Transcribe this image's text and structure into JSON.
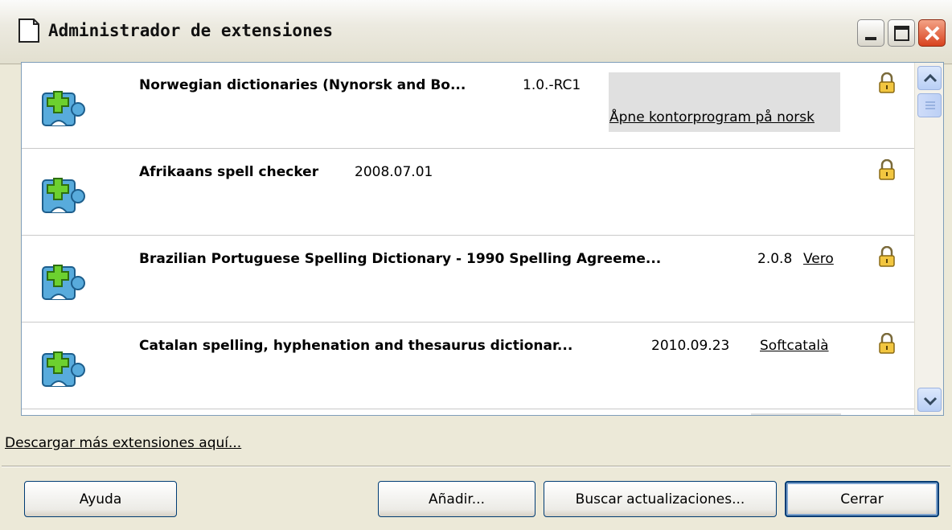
{
  "window": {
    "title": "Administrador de extensiones"
  },
  "extensions": [
    {
      "name": "Norwegian dictionaries (Nynorsk and Bo...",
      "version": "1.0.-RC1",
      "publisher_link": "Åpne kontorprogram på norsk"
    },
    {
      "name": "Afrikaans spell checker",
      "version": "2008.07.01",
      "publisher_link": ""
    },
    {
      "name": "Brazilian Portuguese Spelling Dictionary - 1990 Spelling Agreeme...",
      "version": "2.0.8",
      "publisher_link": "Vero"
    },
    {
      "name": "Catalan spelling, hyphenation and thesaurus dictionar...",
      "version": "2010.09.23",
      "publisher_link": "Softcatalà"
    }
  ],
  "links": {
    "more_extensions": "Descargar más extensiones aquí..."
  },
  "buttons": {
    "help": "Ayuda",
    "add": "Añadir...",
    "check_updates": "Buscar actualizaciones...",
    "close": "Cerrar"
  },
  "icons": {
    "extension": "puzzle-piece-plus-icon",
    "lock": "lock-icon",
    "app": "document-icon"
  },
  "colors": {
    "selection_box": "#e0e0e0",
    "puzzle_blue": "#4aa3d8",
    "plus_green": "#5fbf2a"
  }
}
